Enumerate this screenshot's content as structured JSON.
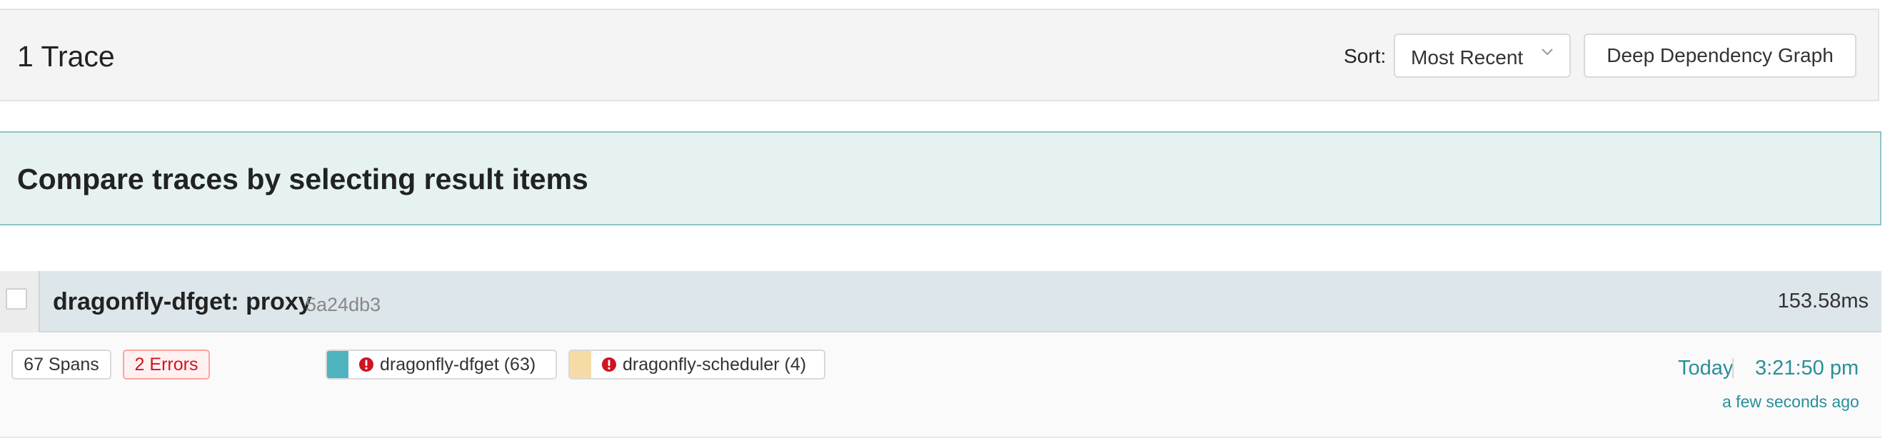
{
  "header": {
    "title": "1 Trace",
    "sort_label": "Sort:",
    "sort_value": "Most Recent",
    "ddg_button": "Deep Dependency Graph"
  },
  "compare": {
    "text": "Compare traces by selecting result items"
  },
  "trace": {
    "name": "dragonfly-dfget: proxy",
    "id": "5a24db3",
    "duration": "153.58ms",
    "spans": "67 Spans",
    "errors": "2 Errors",
    "services": [
      {
        "label": "dragonfly-dfget (63)",
        "color": "#4fb3bf",
        "has_error": true
      },
      {
        "label": "dragonfly-scheduler (4)",
        "color": "#f5dca6",
        "has_error": true
      }
    ],
    "date": "Today",
    "time": "3:21:50 pm",
    "relative": "a few seconds ago"
  },
  "colors": {
    "accent": "#2a8f99",
    "error": "#cf1322"
  }
}
